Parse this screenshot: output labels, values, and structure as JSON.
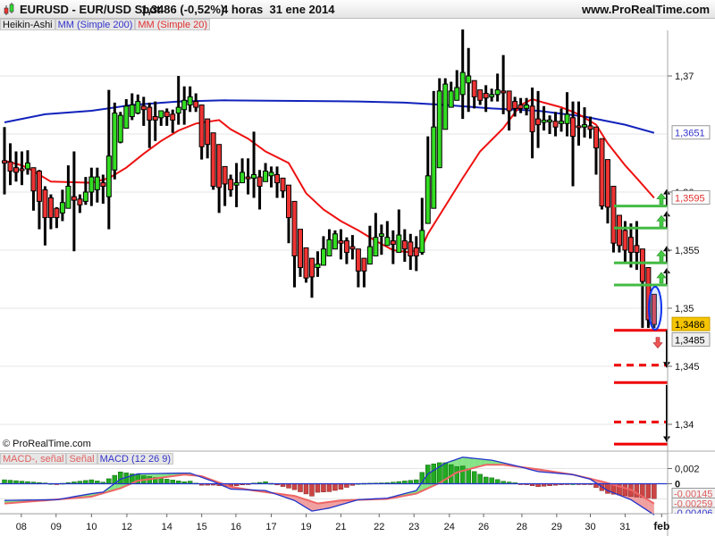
{
  "header": {
    "symbol": "EURUSD - EUR/USD Spot",
    "price_change": "1,3486 (-0,52%)",
    "timeframe_date": "4 horas  31 ene 2014",
    "site": "www.ProRealTime.com"
  },
  "indicator_tabs": [
    "Heikin-Ashi",
    "MM (Simple 200)",
    "MM (Simple 20)"
  ],
  "macd_tabs": [
    "MACD-, señal",
    "Señal",
    "MACD (12 26 9)"
  ],
  "copyright": "© ProRealTime.com",
  "colors": {
    "up": "#33dd22",
    "down": "#ee3333",
    "ma200": "#1122bb",
    "ma20": "#ee1111",
    "level_green": "#44bb44",
    "level_red": "#ee0000"
  },
  "price_axis": {
    "ticks": [
      {
        "v": 1.37,
        "label": "1,37"
      },
      {
        "v": 1.36,
        "label": "1,36"
      },
      {
        "v": 1.355,
        "label": "1,355"
      },
      {
        "v": 1.35,
        "label": "1,35"
      },
      {
        "v": 1.345,
        "label": "1,345"
      },
      {
        "v": 1.34,
        "label": "1,34"
      }
    ],
    "tags": [
      {
        "v": 1.3651,
        "label": "1,3651",
        "style": "ma200"
      },
      {
        "v": 1.3595,
        "label": "1,3595",
        "style": "ma20"
      },
      {
        "v": 1.3486,
        "label": "1,3486",
        "style": "last"
      },
      {
        "v": 1.3485,
        "label": "1,3485",
        "style": "bid"
      }
    ]
  },
  "macd_axis": {
    "ticks": [
      {
        "v": 0.002,
        "label": "0,002"
      },
      {
        "v": 0,
        "label": "0"
      }
    ],
    "tags": [
      {
        "v": -0.00145,
        "label": "-0,00145",
        "style": "hist"
      },
      {
        "v": -0.00259,
        "label": "-0,00259",
        "style": "signal"
      },
      {
        "v": -0.00406,
        "label": "-0,00406",
        "style": "macd"
      }
    ]
  },
  "date_axis": [
    {
      "i": 2.9,
      "label": "08"
    },
    {
      "i": 8.9,
      "label": "09"
    },
    {
      "i": 15,
      "label": "10"
    },
    {
      "i": 21.1,
      "label": "12"
    },
    {
      "i": 28,
      "label": "14"
    },
    {
      "i": 34,
      "label": "15"
    },
    {
      "i": 39.9,
      "label": "16"
    },
    {
      "i": 46,
      "label": "17"
    },
    {
      "i": 52,
      "label": "19"
    },
    {
      "i": 58,
      "label": "21"
    },
    {
      "i": 64.6,
      "label": "22"
    },
    {
      "i": 70.6,
      "label": "23"
    },
    {
      "i": 76.7,
      "label": "24"
    },
    {
      "i": 82.6,
      "label": "26"
    },
    {
      "i": 89.2,
      "label": "28"
    },
    {
      "i": 95.2,
      "label": "29"
    },
    {
      "i": 101,
      "label": "30"
    },
    {
      "i": 107,
      "label": "31"
    },
    {
      "i": 113.3,
      "label": "feb"
    }
  ],
  "chart_data": {
    "type": "candlestick",
    "title": "EURUSD - EUR/USD Spot, Heikin-Ashi, 4 horas",
    "ylim": [
      1.3365,
      1.3745
    ],
    "candles_ohlc": [
      [
        1.3627,
        1.3625,
        1.3656,
        1.3598
      ],
      [
        1.3626,
        1.3618,
        1.3642,
        1.3606
      ],
      [
        1.3621,
        1.3617,
        1.3635,
        1.3609
      ],
      [
        1.362,
        1.3619,
        1.3635,
        1.3606
      ],
      [
        1.362,
        1.3625,
        1.3636,
        1.3615
      ],
      [
        1.3621,
        1.3601,
        1.3621,
        1.3584
      ],
      [
        1.3618,
        1.3592,
        1.3619,
        1.3568
      ],
      [
        1.3602,
        1.3578,
        1.3605,
        1.3554
      ],
      [
        1.3595,
        1.3578,
        1.3598,
        1.3568
      ],
      [
        1.3586,
        1.3578,
        1.3587,
        1.3569
      ],
      [
        1.3582,
        1.3591,
        1.3602,
        1.3575
      ],
      [
        1.3586,
        1.3605,
        1.3623,
        1.3586
      ],
      [
        1.3596,
        1.3593,
        1.3635,
        1.3549
      ],
      [
        1.3594,
        1.3589,
        1.3598,
        1.3582
      ],
      [
        1.3592,
        1.36,
        1.3613,
        1.3589
      ],
      [
        1.36,
        1.3613,
        1.3621,
        1.3588
      ],
      [
        1.3602,
        1.3613,
        1.3621,
        1.3591
      ],
      [
        1.3608,
        1.3605,
        1.3615,
        1.359
      ],
      [
        1.3596,
        1.3631,
        1.3688,
        1.3568
      ],
      [
        1.3619,
        1.3668,
        1.3677,
        1.3611
      ],
      [
        1.3643,
        1.3666,
        1.3669,
        1.3642
      ],
      [
        1.3655,
        1.3674,
        1.368,
        1.3655
      ],
      [
        1.3665,
        1.3675,
        1.3685,
        1.3662
      ],
      [
        1.3668,
        1.3678,
        1.3684,
        1.3667
      ],
      [
        1.3674,
        1.3671,
        1.3682,
        1.3657
      ],
      [
        1.3673,
        1.3662,
        1.3677,
        1.3638
      ],
      [
        1.3665,
        1.3662,
        1.3678,
        1.3644
      ],
      [
        1.3664,
        1.367,
        1.367,
        1.3657
      ],
      [
        1.3669,
        1.3665,
        1.3672,
        1.3657
      ],
      [
        1.3667,
        1.3662,
        1.3671,
        1.3651
      ],
      [
        1.3668,
        1.3673,
        1.37,
        1.3658
      ],
      [
        1.3671,
        1.3679,
        1.3691,
        1.3658
      ],
      [
        1.3675,
        1.3682,
        1.3691,
        1.3669
      ],
      [
        1.3678,
        1.3673,
        1.3685,
        1.3669
      ],
      [
        1.3675,
        1.3639,
        1.3675,
        1.3628
      ],
      [
        1.3663,
        1.3641,
        1.3663,
        1.3629
      ],
      [
        1.3651,
        1.3605,
        1.3651,
        1.3602
      ],
      [
        1.3641,
        1.3604,
        1.3641,
        1.3582
      ],
      [
        1.3622,
        1.3607,
        1.3622,
        1.3588
      ],
      [
        1.3611,
        1.3602,
        1.3615,
        1.3596
      ],
      [
        1.3606,
        1.3608,
        1.3625,
        1.3587
      ],
      [
        1.3608,
        1.3617,
        1.3629,
        1.3608
      ],
      [
        1.3613,
        1.3612,
        1.3629,
        1.3598
      ],
      [
        1.3612,
        1.3615,
        1.3652,
        1.3595
      ],
      [
        1.3613,
        1.3605,
        1.3619,
        1.3585
      ],
      [
        1.3609,
        1.3618,
        1.3625,
        1.3609
      ],
      [
        1.3614,
        1.3617,
        1.3622,
        1.3604
      ],
      [
        1.3615,
        1.3608,
        1.3622,
        1.3595
      ],
      [
        1.3612,
        1.3601,
        1.3612,
        1.3595
      ],
      [
        1.3606,
        1.3578,
        1.3606,
        1.3556
      ],
      [
        1.3592,
        1.3545,
        1.3592,
        1.3518
      ],
      [
        1.3568,
        1.3535,
        1.3568,
        1.3527
      ],
      [
        1.3552,
        1.3526,
        1.3552,
        1.3522
      ],
      [
        1.3543,
        1.3527,
        1.3543,
        1.3509
      ],
      [
        1.3535,
        1.3538,
        1.3549,
        1.3527
      ],
      [
        1.3537,
        1.3551,
        1.3562,
        1.3537
      ],
      [
        1.3545,
        1.3559,
        1.3568,
        1.3545
      ],
      [
        1.3551,
        1.3564,
        1.3567,
        1.3551
      ],
      [
        1.3558,
        1.3556,
        1.3568,
        1.3542
      ],
      [
        1.3558,
        1.3548,
        1.3561,
        1.3538
      ],
      [
        1.3553,
        1.3551,
        1.3563,
        1.3542
      ],
      [
        1.3551,
        1.3532,
        1.3551,
        1.3518
      ],
      [
        1.3543,
        1.3532,
        1.3543,
        1.3518
      ],
      [
        1.3538,
        1.3553,
        1.3571,
        1.3538
      ],
      [
        1.3545,
        1.3561,
        1.3582,
        1.3545
      ],
      [
        1.3562,
        1.3564,
        1.3572,
        1.3546
      ],
      [
        1.3554,
        1.3561,
        1.3575,
        1.3554
      ],
      [
        1.3558,
        1.3555,
        1.3567,
        1.3538
      ],
      [
        1.3548,
        1.3563,
        1.3585,
        1.3548
      ],
      [
        1.3558,
        1.3551,
        1.3568,
        1.354
      ],
      [
        1.3557,
        1.3545,
        1.3564,
        1.3533
      ],
      [
        1.3552,
        1.3545,
        1.3562,
        1.3532
      ],
      [
        1.3548,
        1.3567,
        1.3595,
        1.3546
      ],
      [
        1.3573,
        1.3614,
        1.3648,
        1.3573
      ],
      [
        1.3586,
        1.3656,
        1.3687,
        1.3586
      ],
      [
        1.3621,
        1.3687,
        1.3698,
        1.3621
      ],
      [
        1.3654,
        1.3693,
        1.3698,
        1.3654
      ],
      [
        1.3673,
        1.3687,
        1.3695,
        1.3673
      ],
      [
        1.3679,
        1.369,
        1.3705,
        1.3679
      ],
      [
        1.3684,
        1.3703,
        1.374,
        1.3663
      ],
      [
        1.3694,
        1.37,
        1.3724,
        1.3669
      ],
      [
        1.3696,
        1.3682,
        1.3696,
        1.3672
      ],
      [
        1.3688,
        1.3679,
        1.3688,
        1.3675
      ],
      [
        1.3685,
        1.3681,
        1.3692,
        1.3669
      ],
      [
        1.3682,
        1.3684,
        1.3689,
        1.3678
      ],
      [
        1.3684,
        1.3688,
        1.3702,
        1.3678
      ],
      [
        1.3687,
        1.3686,
        1.3718,
        1.3667
      ],
      [
        1.3687,
        1.367,
        1.3687,
        1.3653
      ],
      [
        1.3678,
        1.3672,
        1.3682,
        1.3665
      ],
      [
        1.3675,
        1.3672,
        1.3681,
        1.3668
      ],
      [
        1.3672,
        1.3675,
        1.3681,
        1.3666
      ],
      [
        1.3674,
        1.3652,
        1.369,
        1.3629
      ],
      [
        1.3663,
        1.3658,
        1.3687,
        1.3638
      ],
      [
        1.366,
        1.3662,
        1.3674,
        1.3653
      ],
      [
        1.3661,
        1.3662,
        1.3666,
        1.365
      ],
      [
        1.3661,
        1.3656,
        1.3669,
        1.3648
      ],
      [
        1.3659,
        1.3661,
        1.3672,
        1.3652
      ],
      [
        1.3659,
        1.3667,
        1.3686,
        1.3648
      ],
      [
        1.3664,
        1.3648,
        1.3678,
        1.3605
      ],
      [
        1.3657,
        1.3656,
        1.3678,
        1.364
      ],
      [
        1.3656,
        1.3658,
        1.3673,
        1.3647
      ],
      [
        1.3657,
        1.3654,
        1.3665,
        1.3646
      ],
      [
        1.3656,
        1.3638,
        1.3656,
        1.3615
      ],
      [
        1.3646,
        1.3588,
        1.3646,
        1.3585
      ],
      [
        1.3628,
        1.3587,
        1.3628,
        1.3573
      ],
      [
        1.3605,
        1.3556,
        1.3605,
        1.3548
      ],
      [
        1.358,
        1.3554,
        1.358,
        1.3548
      ],
      [
        1.3567,
        1.355,
        1.3575,
        1.354
      ],
      [
        1.3561,
        1.3548,
        1.3573,
        1.3535
      ],
      [
        1.3554,
        1.3548,
        1.3575,
        1.3533
      ],
      [
        1.3551,
        1.3523,
        1.3551,
        1.3483
      ],
      [
        1.3535,
        1.349,
        1.3535,
        1.3483
      ],
      [
        1.3512,
        1.3486,
        1.3512,
        1.3483
      ]
    ],
    "series": [
      {
        "name": "MM (Simple 200)",
        "points": [
          [
            0,
            1.366
          ],
          [
            7,
            1.3667
          ],
          [
            15,
            1.367
          ],
          [
            22,
            1.3675
          ],
          [
            30,
            1.3678
          ],
          [
            38,
            1.3679
          ],
          [
            61,
            1.3678
          ],
          [
            69,
            1.3677
          ],
          [
            76,
            1.3675
          ],
          [
            84,
            1.3672
          ],
          [
            92,
            1.367
          ],
          [
            100,
            1.3665
          ],
          [
            107,
            1.3658
          ],
          [
            112,
            1.3651
          ]
        ]
      },
      {
        "name": "MM (Simple 20)",
        "points": [
          [
            0,
            1.3627
          ],
          [
            3,
            1.3623
          ],
          [
            5,
            1.3618
          ],
          [
            8,
            1.3609
          ],
          [
            15,
            1.3608
          ],
          [
            18,
            1.3612
          ],
          [
            21,
            1.3621
          ],
          [
            24,
            1.3633
          ],
          [
            27,
            1.3644
          ],
          [
            30,
            1.3653
          ],
          [
            33,
            1.3659
          ],
          [
            37,
            1.3662
          ],
          [
            39,
            1.3654
          ],
          [
            42,
            1.3646
          ],
          [
            45,
            1.3635
          ],
          [
            49,
            1.3625
          ],
          [
            52,
            1.3599
          ],
          [
            55,
            1.3585
          ],
          [
            58,
            1.3575
          ],
          [
            61,
            1.3567
          ],
          [
            64,
            1.3558
          ],
          [
            67,
            1.355
          ],
          [
            70,
            1.3548
          ],
          [
            72,
            1.3553
          ],
          [
            73,
            1.3564
          ],
          [
            76,
            1.3588
          ],
          [
            79,
            1.3612
          ],
          [
            82,
            1.3635
          ],
          [
            86,
            1.3655
          ],
          [
            89,
            1.3675
          ],
          [
            91,
            1.368
          ],
          [
            93,
            1.3677
          ],
          [
            96,
            1.3673
          ],
          [
            99,
            1.3667
          ],
          [
            102,
            1.3658
          ],
          [
            104,
            1.3642
          ],
          [
            107,
            1.3623
          ],
          [
            109,
            1.3612
          ],
          [
            112,
            1.3595
          ]
        ]
      }
    ],
    "levels": [
      {
        "v": 1.3588,
        "kind": "green"
      },
      {
        "v": 1.3569,
        "kind": "green"
      },
      {
        "v": 1.3539,
        "kind": "green"
      },
      {
        "v": 1.352,
        "kind": "green"
      },
      {
        "v": 1.3481,
        "kind": "red"
      },
      {
        "v": 1.3451,
        "kind": "red-dashed"
      },
      {
        "v": 1.3436,
        "kind": "red"
      },
      {
        "v": 1.3402,
        "kind": "red-dashed"
      },
      {
        "v": 1.3383,
        "kind": "red"
      }
    ],
    "macd": {
      "name": "MACD (12 26 9)",
      "ylim": [
        -0.0043,
        0.0043
      ],
      "macd": [
        [
          0,
          -0.0022
        ],
        [
          9,
          -0.0021
        ],
        [
          15,
          -0.0013
        ],
        [
          17,
          -0.0011
        ],
        [
          20,
          0.0006
        ],
        [
          23,
          0.0013
        ],
        [
          31,
          0.0014
        ],
        [
          32,
          0.0014
        ],
        [
          36,
          0.0003
        ],
        [
          39,
          -0.0007
        ],
        [
          45,
          -0.0009
        ],
        [
          50,
          -0.0022
        ],
        [
          53,
          -0.0036
        ],
        [
          56,
          -0.0032
        ],
        [
          61,
          -0.0021
        ],
        [
          66,
          -0.0019
        ],
        [
          71,
          -0.0009
        ],
        [
          73,
          0.0013
        ],
        [
          76,
          0.0027
        ],
        [
          79,
          0.0035
        ],
        [
          84,
          0.0031
        ],
        [
          88,
          0.0024
        ],
        [
          92,
          0.0016
        ],
        [
          98,
          0.0012
        ],
        [
          101,
          0.0006
        ],
        [
          104,
          -0.0009
        ],
        [
          108,
          -0.0021
        ],
        [
          112,
          -0.0041
        ]
      ],
      "signal": [
        [
          0,
          -0.0026
        ],
        [
          7,
          -0.0022
        ],
        [
          15,
          -0.0017
        ],
        [
          20,
          -0.0006
        ],
        [
          23,
          0.0004
        ],
        [
          31,
          0.0012
        ],
        [
          34,
          0.001
        ],
        [
          39,
          -0.0004
        ],
        [
          43,
          -0.0009
        ],
        [
          50,
          -0.0016
        ],
        [
          54,
          -0.0026
        ],
        [
          58,
          -0.0022
        ],
        [
          66,
          -0.002
        ],
        [
          71,
          -0.0013
        ],
        [
          75,
          0.0001
        ],
        [
          78,
          0.0015
        ],
        [
          83,
          0.0025
        ],
        [
          86,
          0.0025
        ],
        [
          92,
          0.0019
        ],
        [
          98,
          0.0012
        ],
        [
          103,
          0.0003
        ],
        [
          108,
          -0.0008
        ],
        [
          112,
          -0.0026
        ]
      ]
    }
  }
}
